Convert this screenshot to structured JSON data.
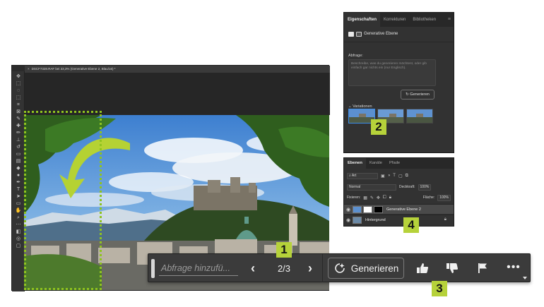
{
  "document": {
    "tab_title": "DSCF7328.RAF bei 33,3% (Generative Ebene 2, Blau/16) *",
    "close_glyph": "×"
  },
  "toolbar": {
    "tools": [
      "move-tool-icon",
      "marquee-tool-icon",
      "lasso-tool-icon",
      "object-select-icon",
      "crop-tool-icon",
      "frame-tool-icon",
      "eyedropper-icon",
      "healing-brush-icon",
      "brush-tool-icon",
      "clone-stamp-icon",
      "history-brush-icon",
      "eraser-icon",
      "gradient-tool-icon",
      "blur-tool-icon",
      "dodge-tool-icon",
      "pen-tool-icon",
      "type-tool-icon",
      "path-select-icon",
      "rectangle-tool-icon",
      "hand-tool-icon",
      "zoom-tool-icon",
      "more-tools-icon",
      "color-swatches-icon",
      "quick-mask-icon",
      "screen-mode-icon"
    ]
  },
  "properties_panel": {
    "tabs": [
      "Eigenschaften",
      "Korrekturen",
      "Bibliotheken"
    ],
    "active_tab": "Eigenschaften",
    "layer_type": "Generative Ebene",
    "prompt_label": "Abfrage:",
    "prompt_placeholder": "Beschreibe, was du generieren möchtest, oder gib einfach gar nichts ein (nur Englisch).",
    "generate_label": "Generieren",
    "variations_label": "Variationen",
    "variations_chevron": "⌄",
    "variation_count": 3,
    "selected_variation": 1
  },
  "layers_panel": {
    "tabs": [
      "Ebenen",
      "Kanäle",
      "Pfade"
    ],
    "active_tab": "Ebenen",
    "filter_kind": "Art",
    "blend_mode": "Normal",
    "opacity_label": "Deckkraft:",
    "opacity_value": "100%",
    "lock_label": "Fixieren:",
    "fill_label": "Fläche:",
    "fill_value": "100%",
    "layers": [
      {
        "name": "Generative Ebene 2",
        "selected": true
      },
      {
        "name": "Hintergrund",
        "selected": false
      }
    ]
  },
  "context_bar": {
    "prompt_placeholder": "Abfrage hinzufü...",
    "prev_glyph": "‹",
    "next_glyph": "›",
    "counter": "2/3",
    "generate_label": "Generieren",
    "more_glyph": "•••"
  },
  "callouts": [
    "1",
    "2",
    "3",
    "4"
  ],
  "colors": {
    "callout_fill": "#b6d23a",
    "selection_dots": "#8fc31f",
    "arrow": "#b5d233",
    "panel_bg": "#323232",
    "bar_bg": "#3b3b3b"
  }
}
